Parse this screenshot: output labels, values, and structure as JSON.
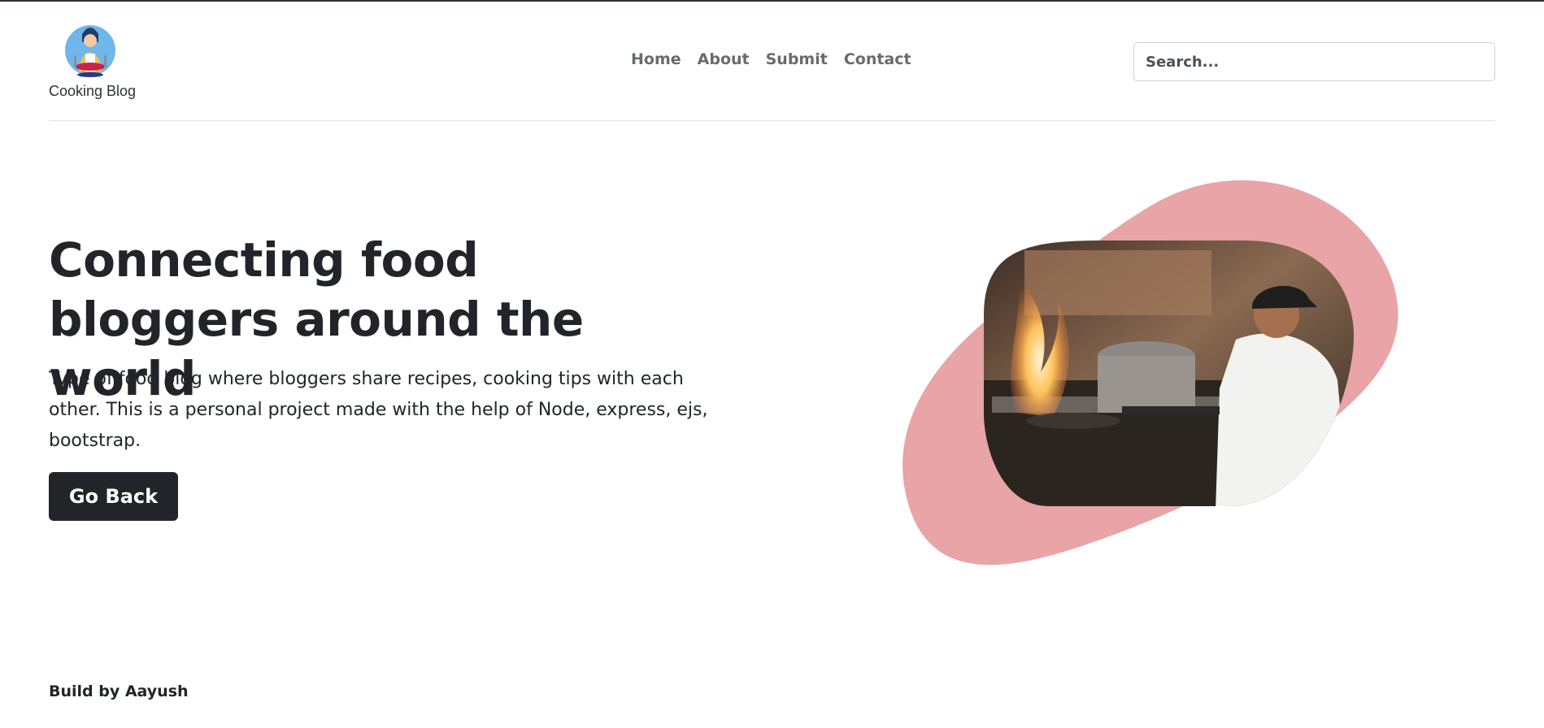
{
  "brand": {
    "name": "Cooking Blog",
    "logo_icon": "chef-woman-icon"
  },
  "nav": {
    "items": [
      {
        "label": "Home"
      },
      {
        "label": "About"
      },
      {
        "label": "Submit"
      },
      {
        "label": "Contact"
      }
    ]
  },
  "search": {
    "placeholder": "Search...",
    "value": ""
  },
  "hero": {
    "title": "Connecting food bloggers around the world",
    "description": "Type of food blog where bloggers share recipes, cooking tips with each other. This is a personal project made with the help of Node, express, ejs, bootstrap.",
    "button_label": "Go Back",
    "image_icon": "chef-flambe-photo",
    "blob_color": "#e8a4a6"
  },
  "footer": {
    "text": "Build by Aayush"
  },
  "colors": {
    "nav_text": "#666b70",
    "dark": "#212529",
    "header_border": "#e3e3e3",
    "top_strip": "#2b2f3a"
  }
}
